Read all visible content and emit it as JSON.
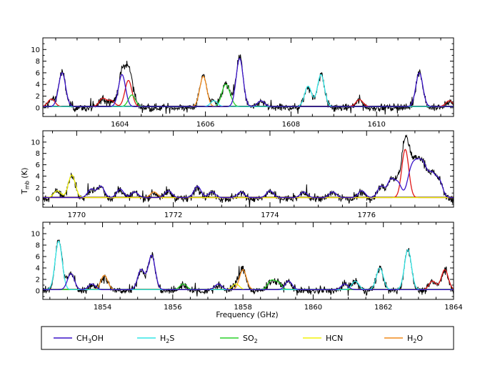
{
  "chart_data": {
    "type": "line",
    "ylabel": "T",
    "ylabel_sub": "mb",
    "ylabel_unit": " (K)",
    "xlabel": "Frequency (GHz)",
    "panels": [
      {
        "xlim": [
          1602.2,
          1611.8
        ],
        "ylim": [
          -1.5,
          12
        ],
        "xticks_major": [
          1604,
          1606,
          1608,
          1610
        ],
        "yticks": [
          0,
          2,
          4,
          6,
          8,
          10
        ],
        "observed": {
          "noise": 0.45,
          "baseline": 0.3
        },
        "lines": [
          {
            "x": 1602.4,
            "h": 1.3,
            "sp": "red"
          },
          {
            "x": 1602.65,
            "h": 5.8,
            "sp": "CH3OH"
          },
          {
            "x": 1603.6,
            "h": 1.4,
            "sp": "red"
          },
          {
            "x": 1603.8,
            "h": 1.0,
            "sp": "red"
          },
          {
            "x": 1604.05,
            "h": 5.5,
            "sp": "CH3OH"
          },
          {
            "x": 1604.2,
            "h": 4.5,
            "sp": "red"
          },
          {
            "x": 1604.28,
            "h": 2.0,
            "sp": "SO2"
          },
          {
            "x": 1605.95,
            "h": 5.2,
            "sp": "H2O"
          },
          {
            "x": 1606.2,
            "h": 1.0,
            "sp": "H2S"
          },
          {
            "x": 1606.45,
            "h": 3.0,
            "sp": "SO2"
          },
          {
            "x": 1606.55,
            "h": 1.5,
            "sp": "SO2"
          },
          {
            "x": 1606.8,
            "h": 8.3,
            "sp": "CH3OH"
          },
          {
            "x": 1607.3,
            "h": 1.0,
            "sp": "CH3OH"
          },
          {
            "x": 1608.4,
            "h": 3.5,
            "sp": "H2S"
          },
          {
            "x": 1608.7,
            "h": 5.5,
            "sp": "H2S"
          },
          {
            "x": 1609.6,
            "h": 1.2,
            "sp": "red"
          },
          {
            "x": 1611.0,
            "h": 5.8,
            "sp": "CH3OH"
          },
          {
            "x": 1611.7,
            "h": 1.0,
            "sp": "red"
          }
        ]
      },
      {
        "xlim": [
          1769.3,
          1777.8
        ],
        "ylim": [
          -1.5,
          12
        ],
        "xticks_major": [
          1770,
          1772,
          1774,
          1776
        ],
        "yticks": [
          0,
          2,
          4,
          6,
          8,
          10
        ],
        "observed": {
          "noise": 0.45,
          "baseline": 0.3
        },
        "lines": [
          {
            "x": 1769.6,
            "h": 1.2,
            "sp": "HCN"
          },
          {
            "x": 1769.9,
            "h": 4.0,
            "sp": "HCN"
          },
          {
            "x": 1770.3,
            "h": 1.5,
            "sp": "CH3OH"
          },
          {
            "x": 1770.5,
            "h": 2.0,
            "sp": "CH3OH"
          },
          {
            "x": 1770.9,
            "h": 1.5,
            "sp": "CH3OH"
          },
          {
            "x": 1771.2,
            "h": 1.0,
            "sp": "CH3OH"
          },
          {
            "x": 1771.6,
            "h": 1.0,
            "sp": "H2O"
          },
          {
            "x": 1771.9,
            "h": 1.2,
            "sp": "CH3OH"
          },
          {
            "x": 1772.5,
            "h": 2.0,
            "sp": "CH3OH"
          },
          {
            "x": 1772.8,
            "h": 1.0,
            "sp": "CH3OH"
          },
          {
            "x": 1773.4,
            "h": 1.0,
            "sp": "CH3OH"
          },
          {
            "x": 1774.0,
            "h": 1.2,
            "sp": "CH3OH"
          },
          {
            "x": 1774.7,
            "h": 1.0,
            "sp": "CH3OH"
          },
          {
            "x": 1775.3,
            "h": 1.0,
            "sp": "CH3OH"
          },
          {
            "x": 1775.9,
            "h": 1.2,
            "sp": "CH3OH"
          },
          {
            "x": 1776.3,
            "h": 2.0,
            "sp": "CH3OH"
          },
          {
            "x": 1776.5,
            "h": 3.0,
            "sp": "CH3OH"
          },
          {
            "x": 1776.65,
            "h": 2.5,
            "sp": "CH3OH"
          },
          {
            "x": 1776.8,
            "h": 8.5,
            "sp": "red"
          },
          {
            "x": 1776.9,
            "h": 3.5,
            "sp": "CH3OH"
          },
          {
            "x": 1777.0,
            "h": 3.8,
            "sp": "CH3OH"
          },
          {
            "x": 1777.1,
            "h": 3.8,
            "sp": "CH3OH"
          },
          {
            "x": 1777.2,
            "h": 4.0,
            "sp": "CH3OH"
          },
          {
            "x": 1777.35,
            "h": 3.8,
            "sp": "CH3OH"
          },
          {
            "x": 1777.5,
            "h": 3.0,
            "sp": "CH3OH"
          }
        ]
      },
      {
        "xlim": [
          1852.3,
          1864.0
        ],
        "ylim": [
          -1.5,
          12
        ],
        "xticks_major": [
          1854,
          1856,
          1858,
          1860,
          1862,
          1864
        ],
        "yticks": [
          0,
          2,
          4,
          6,
          8,
          10
        ],
        "observed": {
          "noise": 0.45,
          "baseline": 0.3
        },
        "lines": [
          {
            "x": 1852.75,
            "h": 8.5,
            "sp": "H2S"
          },
          {
            "x": 1853.1,
            "h": 2.8,
            "sp": "CH3OH"
          },
          {
            "x": 1853.7,
            "h": 1.0,
            "sp": "CH3OH"
          },
          {
            "x": 1854.05,
            "h": 2.5,
            "sp": "H2O"
          },
          {
            "x": 1855.1,
            "h": 3.5,
            "sp": "CH3OH"
          },
          {
            "x": 1855.4,
            "h": 6.0,
            "sp": "CH3OH"
          },
          {
            "x": 1856.3,
            "h": 1.0,
            "sp": "SO2"
          },
          {
            "x": 1857.3,
            "h": 1.0,
            "sp": "CH3OH"
          },
          {
            "x": 1857.8,
            "h": 1.0,
            "sp": "HCN"
          },
          {
            "x": 1858.0,
            "h": 3.5,
            "sp": "H2O"
          },
          {
            "x": 1858.8,
            "h": 1.5,
            "sp": "SO2"
          },
          {
            "x": 1859.0,
            "h": 1.2,
            "sp": "SO2"
          },
          {
            "x": 1859.3,
            "h": 1.5,
            "sp": "CH3OH"
          },
          {
            "x": 1860.9,
            "h": 1.0,
            "sp": "CH3OH"
          },
          {
            "x": 1861.2,
            "h": 1.5,
            "sp": "H2S"
          },
          {
            "x": 1861.9,
            "h": 3.8,
            "sp": "H2S"
          },
          {
            "x": 1862.7,
            "h": 7.0,
            "sp": "H2S"
          },
          {
            "x": 1863.4,
            "h": 1.5,
            "sp": "red"
          },
          {
            "x": 1863.75,
            "h": 3.5,
            "sp": "red"
          }
        ]
      }
    ],
    "legend": [
      {
        "key": "CH3OH",
        "main": "CH",
        "sub": "3",
        "tail": "OH",
        "color": "#3b14c8"
      },
      {
        "key": "H2S",
        "main": "H",
        "sub": "2",
        "tail": "S",
        "color": "#33e6e6"
      },
      {
        "key": "SO2",
        "main": "SO",
        "sub": "2",
        "tail": "",
        "color": "#2ad12a"
      },
      {
        "key": "HCN",
        "main": "HCN",
        "sub": "",
        "tail": "",
        "color": "#f2f20a"
      },
      {
        "key": "H2O",
        "main": "H",
        "sub": "2",
        "tail": "O",
        "color": "#f08a1c"
      }
    ],
    "extra_colors": {
      "red": "#e01818",
      "observed": "#000000",
      "baseline": "#000000"
    }
  }
}
